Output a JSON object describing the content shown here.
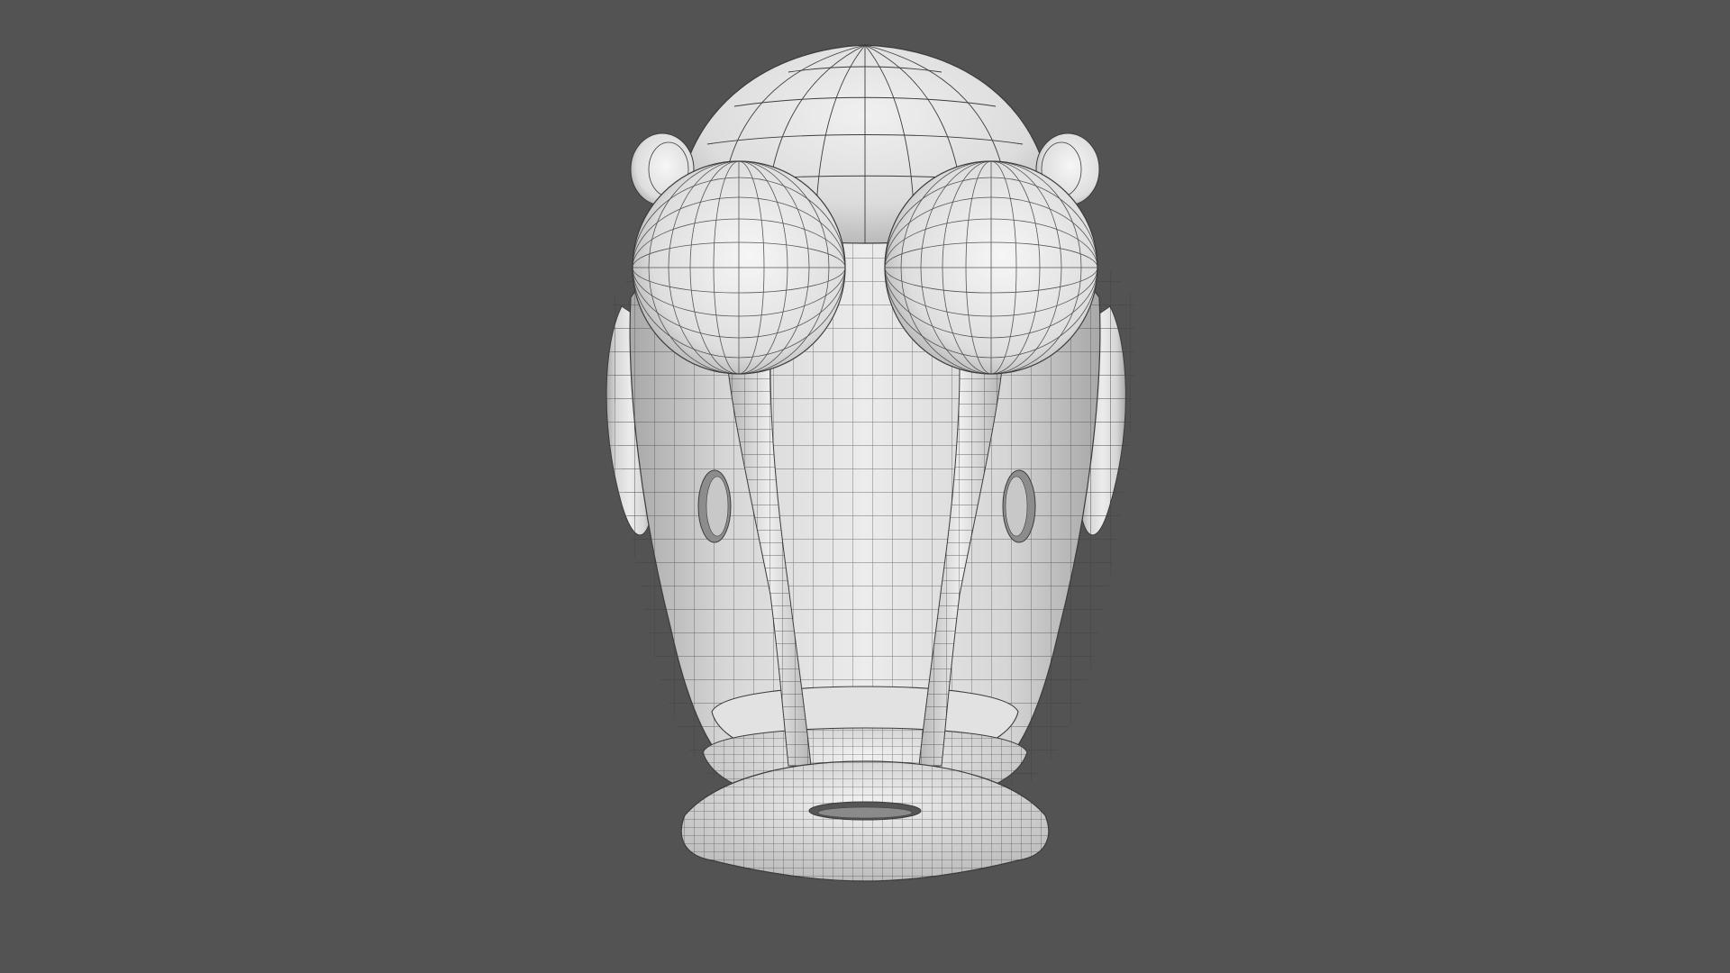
{
  "scene": {
    "background_color": "#535353",
    "mesh_color": "#d9d9d9",
    "wire_color": "#3c3c3c",
    "subject": "wireframe-creature-head-model"
  }
}
